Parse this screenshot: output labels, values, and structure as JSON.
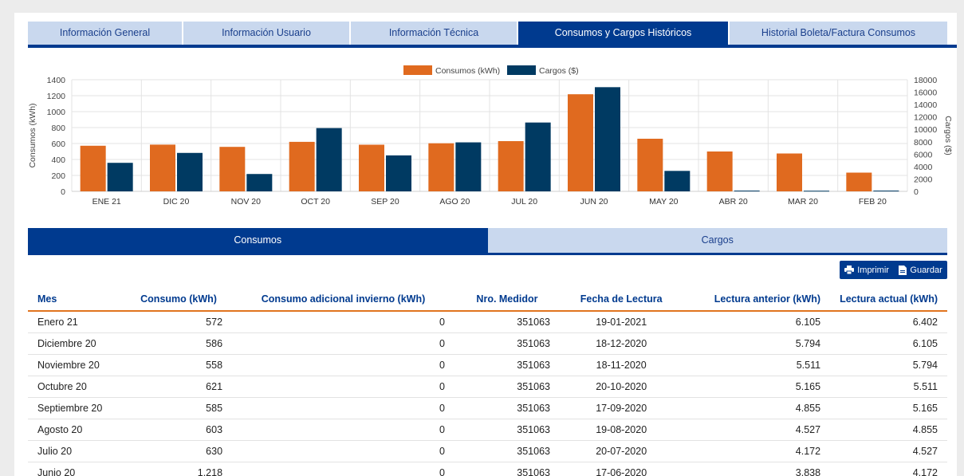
{
  "tabs": [
    {
      "label": "Información General",
      "active": false
    },
    {
      "label": "Información Usuario",
      "active": false
    },
    {
      "label": "Información Técnica",
      "active": false
    },
    {
      "label": "Consumos y Cargos Históricos",
      "active": true
    },
    {
      "label": "Historial Boleta/Factura Consumos",
      "active": false
    }
  ],
  "subtabs": [
    {
      "label": "Consumos",
      "active": true
    },
    {
      "label": "Cargos",
      "active": false
    }
  ],
  "actions": {
    "print_label": "Imprimir",
    "save_label": "Guardar"
  },
  "colors": {
    "accent": "#003a8f",
    "consumo": "#e06a1f",
    "cargo": "#003a62",
    "tab_inactive": "#c9d8ee"
  },
  "chart_data": {
    "type": "bar",
    "categories": [
      "ENE 21",
      "DIC 20",
      "NOV 20",
      "OCT 20",
      "SEP 20",
      "AGO 20",
      "JUL 20",
      "JUN 20",
      "MAY 20",
      "ABR 20",
      "MAR 20",
      "FEB 20"
    ],
    "series": [
      {
        "name": "Consumos (kWh)",
        "axis": "left",
        "color": "#e06a1f",
        "values": [
          572,
          586,
          558,
          621,
          585,
          603,
          630,
          1218,
          660,
          500,
          475,
          235
        ]
      },
      {
        "name": "Cargos ($)",
        "axis": "right",
        "color": "#003a62",
        "values": [
          4600,
          6200,
          2800,
          10200,
          5800,
          7900,
          11100,
          16800,
          3300,
          120,
          100,
          120
        ]
      }
    ],
    "ylabel": "Consumos (kWh)",
    "y2label": "Cargos ($)",
    "ylim": [
      0,
      1400
    ],
    "y2lim": [
      0,
      18000
    ],
    "yticks": [
      0,
      200,
      400,
      600,
      800,
      1000,
      1200,
      1400
    ],
    "y2ticks": [
      0,
      2000,
      4000,
      6000,
      8000,
      10000,
      12000,
      14000,
      16000,
      18000
    ],
    "legend": "top-center",
    "grid": true
  },
  "table": {
    "columns": [
      "Mes",
      "Consumo (kWh)",
      "Consumo adicional invierno (kWh)",
      "Nro. Medidor",
      "Fecha de Lectura",
      "Lectura anterior (kWh)",
      "Lectura actual (kWh)"
    ],
    "rows": [
      [
        "Enero 21",
        "572",
        "0",
        "351063",
        "19-01-2021",
        "6.105",
        "6.402"
      ],
      [
        "Diciembre 20",
        "586",
        "0",
        "351063",
        "18-12-2020",
        "5.794",
        "6.105"
      ],
      [
        "Noviembre 20",
        "558",
        "0",
        "351063",
        "18-11-2020",
        "5.511",
        "5.794"
      ],
      [
        "Octubre 20",
        "621",
        "0",
        "351063",
        "20-10-2020",
        "5.165",
        "5.511"
      ],
      [
        "Septiembre 20",
        "585",
        "0",
        "351063",
        "17-09-2020",
        "4.855",
        "5.165"
      ],
      [
        "Agosto 20",
        "603",
        "0",
        "351063",
        "19-08-2020",
        "4.527",
        "4.855"
      ],
      [
        "Julio 20",
        "630",
        "0",
        "351063",
        "20-07-2020",
        "4.172",
        "4.527"
      ],
      [
        "Junio 20",
        "1.218",
        "0",
        "351063",
        "17-06-2020",
        "3.838",
        "4.172"
      ]
    ]
  }
}
